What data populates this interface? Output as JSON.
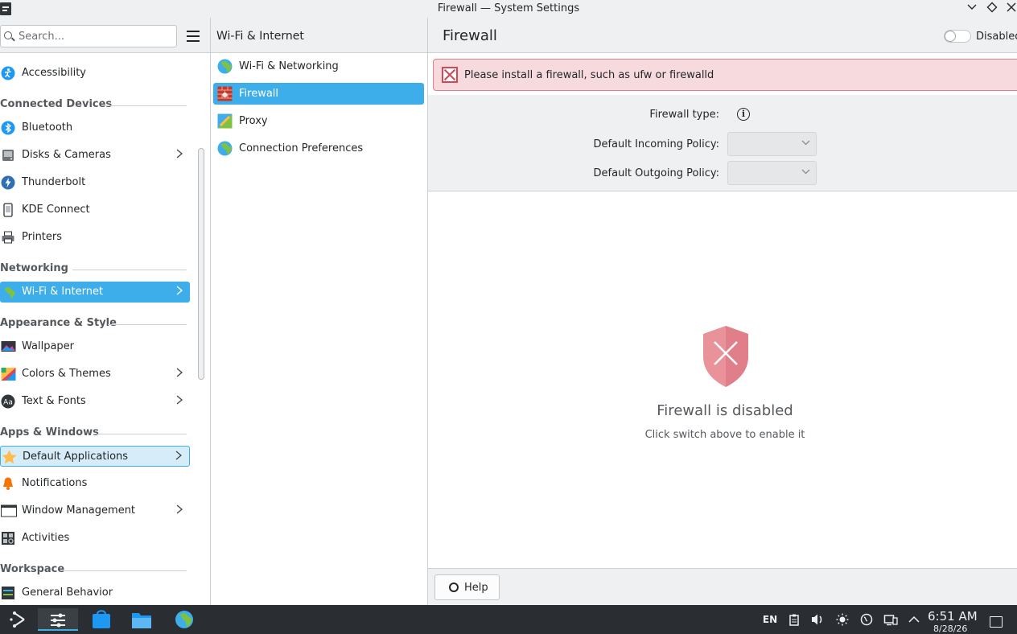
{
  "window": {
    "title": "Firewall — System Settings",
    "controls": [
      "minimize",
      "maximize",
      "close"
    ]
  },
  "sidebar": {
    "search_placeholder": "Search...",
    "entries": [
      {
        "type": "item",
        "label": "Accessibility",
        "icon": "accessibility-icon",
        "arrow": false
      },
      {
        "type": "category",
        "label": "Connected Devices"
      },
      {
        "type": "item",
        "label": "Bluetooth",
        "icon": "bluetooth-icon",
        "arrow": false
      },
      {
        "type": "item",
        "label": "Disks & Cameras",
        "icon": "disk-icon",
        "arrow": true
      },
      {
        "type": "item",
        "label": "Thunderbolt",
        "icon": "thunderbolt-icon",
        "arrow": false
      },
      {
        "type": "item",
        "label": "KDE Connect",
        "icon": "phone-icon",
        "arrow": false
      },
      {
        "type": "item",
        "label": "Printers",
        "icon": "printer-icon",
        "arrow": false
      },
      {
        "type": "category",
        "label": "Networking"
      },
      {
        "type": "item",
        "label": "Wi-Fi & Internet",
        "icon": "globe-icon",
        "arrow": true,
        "state": "active"
      },
      {
        "type": "category",
        "label": "Appearance & Style"
      },
      {
        "type": "item",
        "label": "Wallpaper",
        "icon": "wallpaper-icon",
        "arrow": false
      },
      {
        "type": "item",
        "label": "Colors & Themes",
        "icon": "palette-icon",
        "arrow": true
      },
      {
        "type": "item",
        "label": "Text & Fonts",
        "icon": "font-icon",
        "arrow": true
      },
      {
        "type": "category",
        "label": "Apps & Windows"
      },
      {
        "type": "item",
        "label": "Default Applications",
        "icon": "star-icon",
        "arrow": true,
        "state": "hover"
      },
      {
        "type": "item",
        "label": "Notifications",
        "icon": "bell-icon",
        "arrow": false
      },
      {
        "type": "item",
        "label": "Window Management",
        "icon": "window-icon",
        "arrow": true
      },
      {
        "type": "item",
        "label": "Activities",
        "icon": "activities-icon",
        "arrow": false
      },
      {
        "type": "category",
        "label": "Workspace"
      },
      {
        "type": "item",
        "label": "General Behavior",
        "icon": "general-behavior-icon",
        "arrow": false
      }
    ]
  },
  "middle": {
    "title": "Wi-Fi & Internet",
    "items": [
      {
        "label": "Wi-Fi & Networking",
        "icon": "globe-icon"
      },
      {
        "label": "Firewall",
        "icon": "firewall-icon",
        "active": true
      },
      {
        "label": "Proxy",
        "icon": "proxy-icon"
      },
      {
        "label": "Connection Preferences",
        "icon": "globe-icon"
      }
    ]
  },
  "main": {
    "title": "Firewall",
    "toggle_label": "Disabled",
    "toggle_on": false,
    "banner": "Please install a firewall, such as ufw or firewalld",
    "firewall_type_label": "Firewall type:",
    "incoming_label": "Default Incoming Policy:",
    "incoming_value": "",
    "outgoing_label": "Default Outgoing Policy:",
    "outgoing_value": "",
    "empty_title": "Firewall is disabled",
    "empty_subtitle": "Click switch above to enable it",
    "help_label": "Help"
  },
  "taskbar": {
    "apps": [
      "app-launcher-icon",
      "system-settings-icon",
      "discover-icon",
      "file-manager-icon",
      "globe-icon"
    ],
    "keyboard_layout": "EN",
    "time": "6:51 AM",
    "date": "8/28/26"
  },
  "colors": {
    "accent": "#3daee9",
    "error": "#da4453",
    "banner_bg": "#f6dadd",
    "taskbar": "#2a2e32"
  }
}
